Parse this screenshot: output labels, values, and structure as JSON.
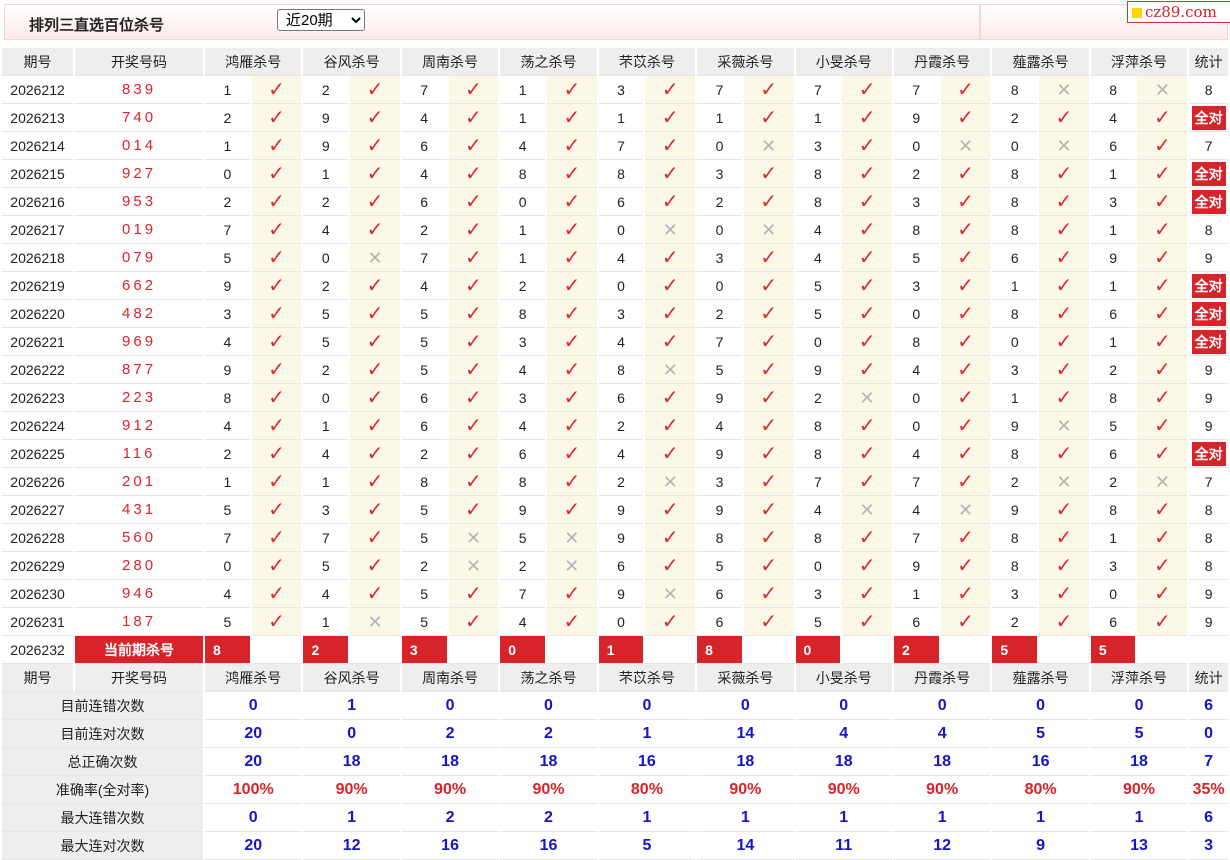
{
  "header": {
    "title": "排列三直选百位杀号",
    "period_select": "近20期",
    "logo_text": "cz89.com"
  },
  "table": {
    "columns": [
      "期号",
      "开奖号码",
      "鸿雁杀号",
      "谷风杀号",
      "周南杀号",
      "荡之杀号",
      "芣苡杀号",
      "采薇杀号",
      "小旻杀号",
      "丹霞杀号",
      "薤露杀号",
      "浮萍杀号",
      "统计"
    ],
    "rows": [
      {
        "issue": "2026212",
        "draw": "839",
        "k": [
          "1",
          "2",
          "7",
          "1",
          "3",
          "7",
          "7",
          "7",
          "8",
          "8"
        ],
        "r": [
          1,
          1,
          1,
          1,
          1,
          1,
          1,
          1,
          0,
          0
        ],
        "stat": "8"
      },
      {
        "issue": "2026213",
        "draw": "740",
        "k": [
          "2",
          "9",
          "4",
          "1",
          "1",
          "1",
          "1",
          "9",
          "2",
          "4"
        ],
        "r": [
          1,
          1,
          1,
          1,
          1,
          1,
          1,
          1,
          1,
          1
        ],
        "stat": "全对"
      },
      {
        "issue": "2026214",
        "draw": "014",
        "k": [
          "1",
          "9",
          "6",
          "4",
          "7",
          "0",
          "3",
          "0",
          "0",
          "6"
        ],
        "r": [
          1,
          1,
          1,
          1,
          1,
          0,
          1,
          0,
          0,
          1
        ],
        "stat": "7"
      },
      {
        "issue": "2026215",
        "draw": "927",
        "k": [
          "0",
          "1",
          "4",
          "8",
          "8",
          "3",
          "8",
          "2",
          "8",
          "1"
        ],
        "r": [
          1,
          1,
          1,
          1,
          1,
          1,
          1,
          1,
          1,
          1
        ],
        "stat": "全对"
      },
      {
        "issue": "2026216",
        "draw": "953",
        "k": [
          "2",
          "2",
          "6",
          "0",
          "6",
          "2",
          "8",
          "3",
          "8",
          "3"
        ],
        "r": [
          1,
          1,
          1,
          1,
          1,
          1,
          1,
          1,
          1,
          1
        ],
        "stat": "全对"
      },
      {
        "issue": "2026217",
        "draw": "019",
        "k": [
          "7",
          "4",
          "2",
          "1",
          "0",
          "0",
          "4",
          "8",
          "8",
          "1"
        ],
        "r": [
          1,
          1,
          1,
          1,
          0,
          0,
          1,
          1,
          1,
          1
        ],
        "stat": "8"
      },
      {
        "issue": "2026218",
        "draw": "079",
        "k": [
          "5",
          "0",
          "7",
          "1",
          "4",
          "3",
          "4",
          "5",
          "6",
          "9"
        ],
        "r": [
          1,
          0,
          1,
          1,
          1,
          1,
          1,
          1,
          1,
          1
        ],
        "stat": "9"
      },
      {
        "issue": "2026219",
        "draw": "662",
        "k": [
          "9",
          "2",
          "4",
          "2",
          "0",
          "0",
          "5",
          "3",
          "1",
          "1"
        ],
        "r": [
          1,
          1,
          1,
          1,
          1,
          1,
          1,
          1,
          1,
          1
        ],
        "stat": "全对"
      },
      {
        "issue": "2026220",
        "draw": "482",
        "k": [
          "3",
          "5",
          "5",
          "8",
          "3",
          "2",
          "5",
          "0",
          "8",
          "6"
        ],
        "r": [
          1,
          1,
          1,
          1,
          1,
          1,
          1,
          1,
          1,
          1
        ],
        "stat": "全对"
      },
      {
        "issue": "2026221",
        "draw": "969",
        "k": [
          "4",
          "5",
          "5",
          "3",
          "4",
          "7",
          "0",
          "8",
          "0",
          "1"
        ],
        "r": [
          1,
          1,
          1,
          1,
          1,
          1,
          1,
          1,
          1,
          1
        ],
        "stat": "全对"
      },
      {
        "issue": "2026222",
        "draw": "877",
        "k": [
          "9",
          "2",
          "5",
          "4",
          "8",
          "5",
          "9",
          "4",
          "3",
          "2"
        ],
        "r": [
          1,
          1,
          1,
          1,
          0,
          1,
          1,
          1,
          1,
          1
        ],
        "stat": "9"
      },
      {
        "issue": "2026223",
        "draw": "223",
        "k": [
          "8",
          "0",
          "6",
          "3",
          "6",
          "9",
          "2",
          "0",
          "1",
          "8"
        ],
        "r": [
          1,
          1,
          1,
          1,
          1,
          1,
          0,
          1,
          1,
          1
        ],
        "stat": "9"
      },
      {
        "issue": "2026224",
        "draw": "912",
        "k": [
          "4",
          "1",
          "6",
          "4",
          "2",
          "4",
          "8",
          "0",
          "9",
          "5"
        ],
        "r": [
          1,
          1,
          1,
          1,
          1,
          1,
          1,
          1,
          0,
          1
        ],
        "stat": "9"
      },
      {
        "issue": "2026225",
        "draw": "116",
        "k": [
          "2",
          "4",
          "2",
          "6",
          "4",
          "9",
          "8",
          "4",
          "8",
          "6"
        ],
        "r": [
          1,
          1,
          1,
          1,
          1,
          1,
          1,
          1,
          1,
          1
        ],
        "stat": "全对"
      },
      {
        "issue": "2026226",
        "draw": "201",
        "k": [
          "1",
          "1",
          "8",
          "8",
          "2",
          "3",
          "7",
          "7",
          "2",
          "2"
        ],
        "r": [
          1,
          1,
          1,
          1,
          0,
          1,
          1,
          1,
          0,
          0
        ],
        "stat": "7"
      },
      {
        "issue": "2026227",
        "draw": "431",
        "k": [
          "5",
          "3",
          "5",
          "9",
          "9",
          "9",
          "4",
          "4",
          "9",
          "8"
        ],
        "r": [
          1,
          1,
          1,
          1,
          1,
          1,
          0,
          0,
          1,
          1
        ],
        "stat": "8"
      },
      {
        "issue": "2026228",
        "draw": "560",
        "k": [
          "7",
          "7",
          "5",
          "5",
          "9",
          "8",
          "8",
          "7",
          "8",
          "1"
        ],
        "r": [
          1,
          1,
          0,
          0,
          1,
          1,
          1,
          1,
          1,
          1
        ],
        "stat": "8"
      },
      {
        "issue": "2026229",
        "draw": "280",
        "k": [
          "0",
          "5",
          "2",
          "2",
          "6",
          "5",
          "0",
          "9",
          "8",
          "3"
        ],
        "r": [
          1,
          1,
          0,
          0,
          1,
          1,
          1,
          1,
          1,
          1
        ],
        "stat": "8"
      },
      {
        "issue": "2026230",
        "draw": "946",
        "k": [
          "4",
          "4",
          "5",
          "7",
          "9",
          "6",
          "3",
          "1",
          "3",
          "0"
        ],
        "r": [
          1,
          1,
          1,
          1,
          0,
          1,
          1,
          1,
          1,
          1
        ],
        "stat": "9"
      },
      {
        "issue": "2026231",
        "draw": "187",
        "k": [
          "5",
          "1",
          "5",
          "4",
          "0",
          "6",
          "5",
          "6",
          "2",
          "6"
        ],
        "r": [
          1,
          0,
          1,
          1,
          1,
          1,
          1,
          1,
          1,
          1
        ],
        "stat": "9"
      }
    ],
    "current": {
      "issue": "2026232",
      "label": "当前期杀号",
      "k": [
        "8",
        "2",
        "3",
        "0",
        "1",
        "8",
        "0",
        "2",
        "5",
        "5"
      ]
    },
    "summary": [
      {
        "label": "目前连错次数",
        "vals": [
          "0",
          "1",
          "0",
          "0",
          "0",
          "0",
          "0",
          "0",
          "0",
          "0"
        ],
        "stat": "6"
      },
      {
        "label": "目前连对次数",
        "vals": [
          "20",
          "0",
          "2",
          "2",
          "1",
          "14",
          "4",
          "4",
          "5",
          "5"
        ],
        "stat": "0"
      },
      {
        "label": "总正确次数",
        "vals": [
          "20",
          "18",
          "18",
          "18",
          "16",
          "18",
          "18",
          "18",
          "16",
          "18"
        ],
        "stat": "7"
      },
      {
        "label": "准确率(全对率)",
        "vals": [
          "100%",
          "90%",
          "90%",
          "90%",
          "80%",
          "90%",
          "90%",
          "90%",
          "80%",
          "90%"
        ],
        "stat": "35%",
        "pct": true
      },
      {
        "label": "最大连错次数",
        "vals": [
          "0",
          "1",
          "2",
          "2",
          "1",
          "1",
          "1",
          "1",
          "1",
          "1"
        ],
        "stat": "6"
      },
      {
        "label": "最大连对次数",
        "vals": [
          "20",
          "12",
          "16",
          "16",
          "5",
          "14",
          "11",
          "12",
          "9",
          "13"
        ],
        "stat": "3"
      }
    ]
  },
  "icons": {
    "correct": "check-icon",
    "wrong": "cross-icon"
  },
  "colors": {
    "accent": "#d7242b",
    "summary_blue": "#1515c8",
    "mark_bg": "#fbf8e8"
  }
}
